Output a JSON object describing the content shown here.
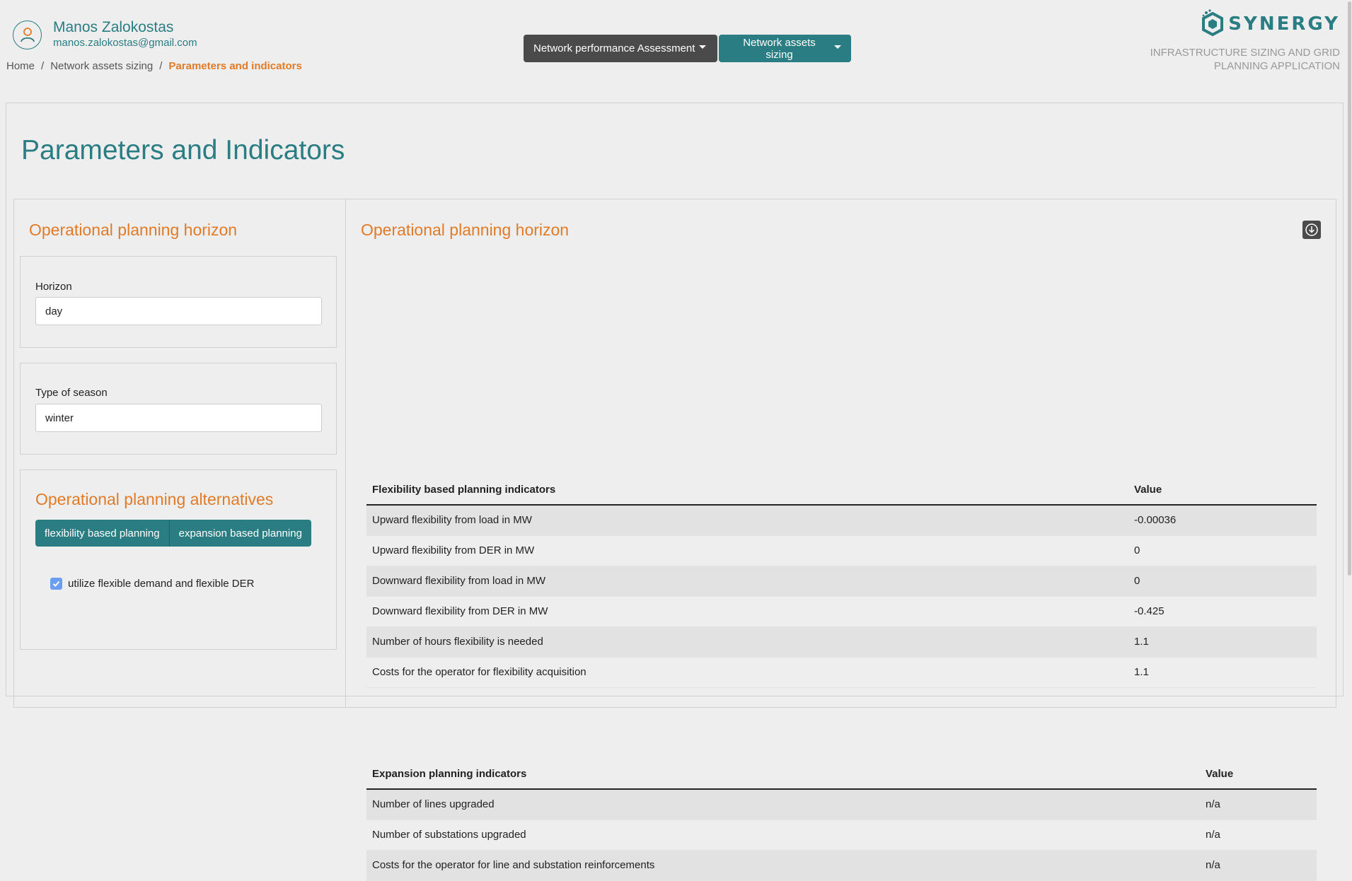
{
  "user": {
    "name": "Manos Zalokostas",
    "email": "manos.zalokostas@gmail.com"
  },
  "breadcrumb": {
    "items": [
      "Home",
      "Network assets sizing",
      "Parameters and indicators"
    ],
    "separator": "/"
  },
  "nav": {
    "performance_label": "Network performance Assessment",
    "sizing_label": "Network assets sizing"
  },
  "brand": {
    "logo_text": "SYNERGY",
    "subtitle": "INFRASTRUCTURE SIZING AND GRID PLANNING APPLICATION"
  },
  "page": {
    "title": "Parameters and Indicators"
  },
  "left_panel": {
    "heading": "Operational planning horizon",
    "horizon": {
      "label": "Horizon",
      "value": "day"
    },
    "season": {
      "label": "Type of season",
      "value": "winter"
    },
    "alternatives": {
      "heading": "Operational planning alternatives",
      "buttons": [
        "flexibility based planning",
        "expansion based planning"
      ],
      "checkbox_label": "utilize flexible demand and flexible DER",
      "checkbox_checked": true
    }
  },
  "right_panel": {
    "heading": "Operational planning horizon",
    "flex_table": {
      "headers": [
        "Flexibility based planning indicators",
        "Value"
      ],
      "rows": [
        [
          "Upward flexibility from load in MW",
          "-0.00036"
        ],
        [
          "Upward flexibility from DER in MW",
          "0"
        ],
        [
          "Downward flexibility from load in MW",
          "0"
        ],
        [
          "Downward flexibility from DER in MW",
          "-0.425"
        ],
        [
          "Number of hours flexibility is needed",
          "1.1"
        ],
        [
          "Costs for the operator for flexibility acquisition",
          "1.1"
        ]
      ]
    },
    "exp_table": {
      "headers": [
        "Expansion planning indicators",
        "Value"
      ],
      "rows": [
        [
          "Number of lines upgraded",
          "n/a"
        ],
        [
          "Number of substations upgraded",
          "n/a"
        ],
        [
          "Costs for the operator for line and substation reinforcements",
          "n/a"
        ]
      ]
    }
  },
  "colors": {
    "teal": "#2a7d82",
    "orange": "#e07b28",
    "dark_button": "#4a4a4a",
    "background": "#eeeeee"
  },
  "icons": [
    "user-avatar-icon",
    "synergy-logo-icon",
    "download-icon",
    "checkmark-icon",
    "caret-down-icon"
  ]
}
